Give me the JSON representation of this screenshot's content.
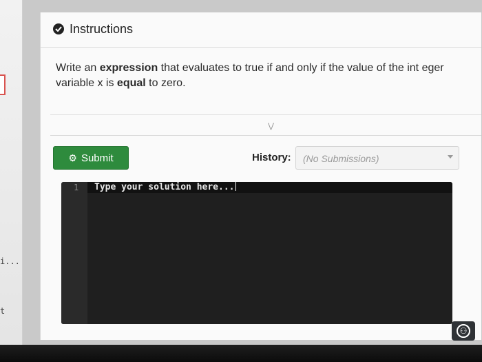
{
  "instructions": {
    "title": "Instructions",
    "body_parts": [
      "Write an ",
      "expression",
      " that evaluates to true if and only if the value of the int eger variable x is ",
      "equal",
      " to zero."
    ]
  },
  "toolbar": {
    "submit_label": "Submit",
    "history_label": "History:",
    "history_value": "(No Submissions)"
  },
  "editor": {
    "line_number": "1",
    "placeholder": "Type your solution here..."
  },
  "left_panel": {
    "snippet_1": "i...",
    "snippet_2": "t"
  },
  "icons": {
    "instructions": "check-circle-icon",
    "submit": "gear-icon",
    "history": "chevron-down-icon",
    "collapse": "double-chevron-down-icon",
    "accessibility": "accessibility-icon"
  },
  "colors": {
    "submit_button": "#2e8b3d",
    "editor_background": "#1f1f1f",
    "alert_marker": "#d9534f"
  }
}
